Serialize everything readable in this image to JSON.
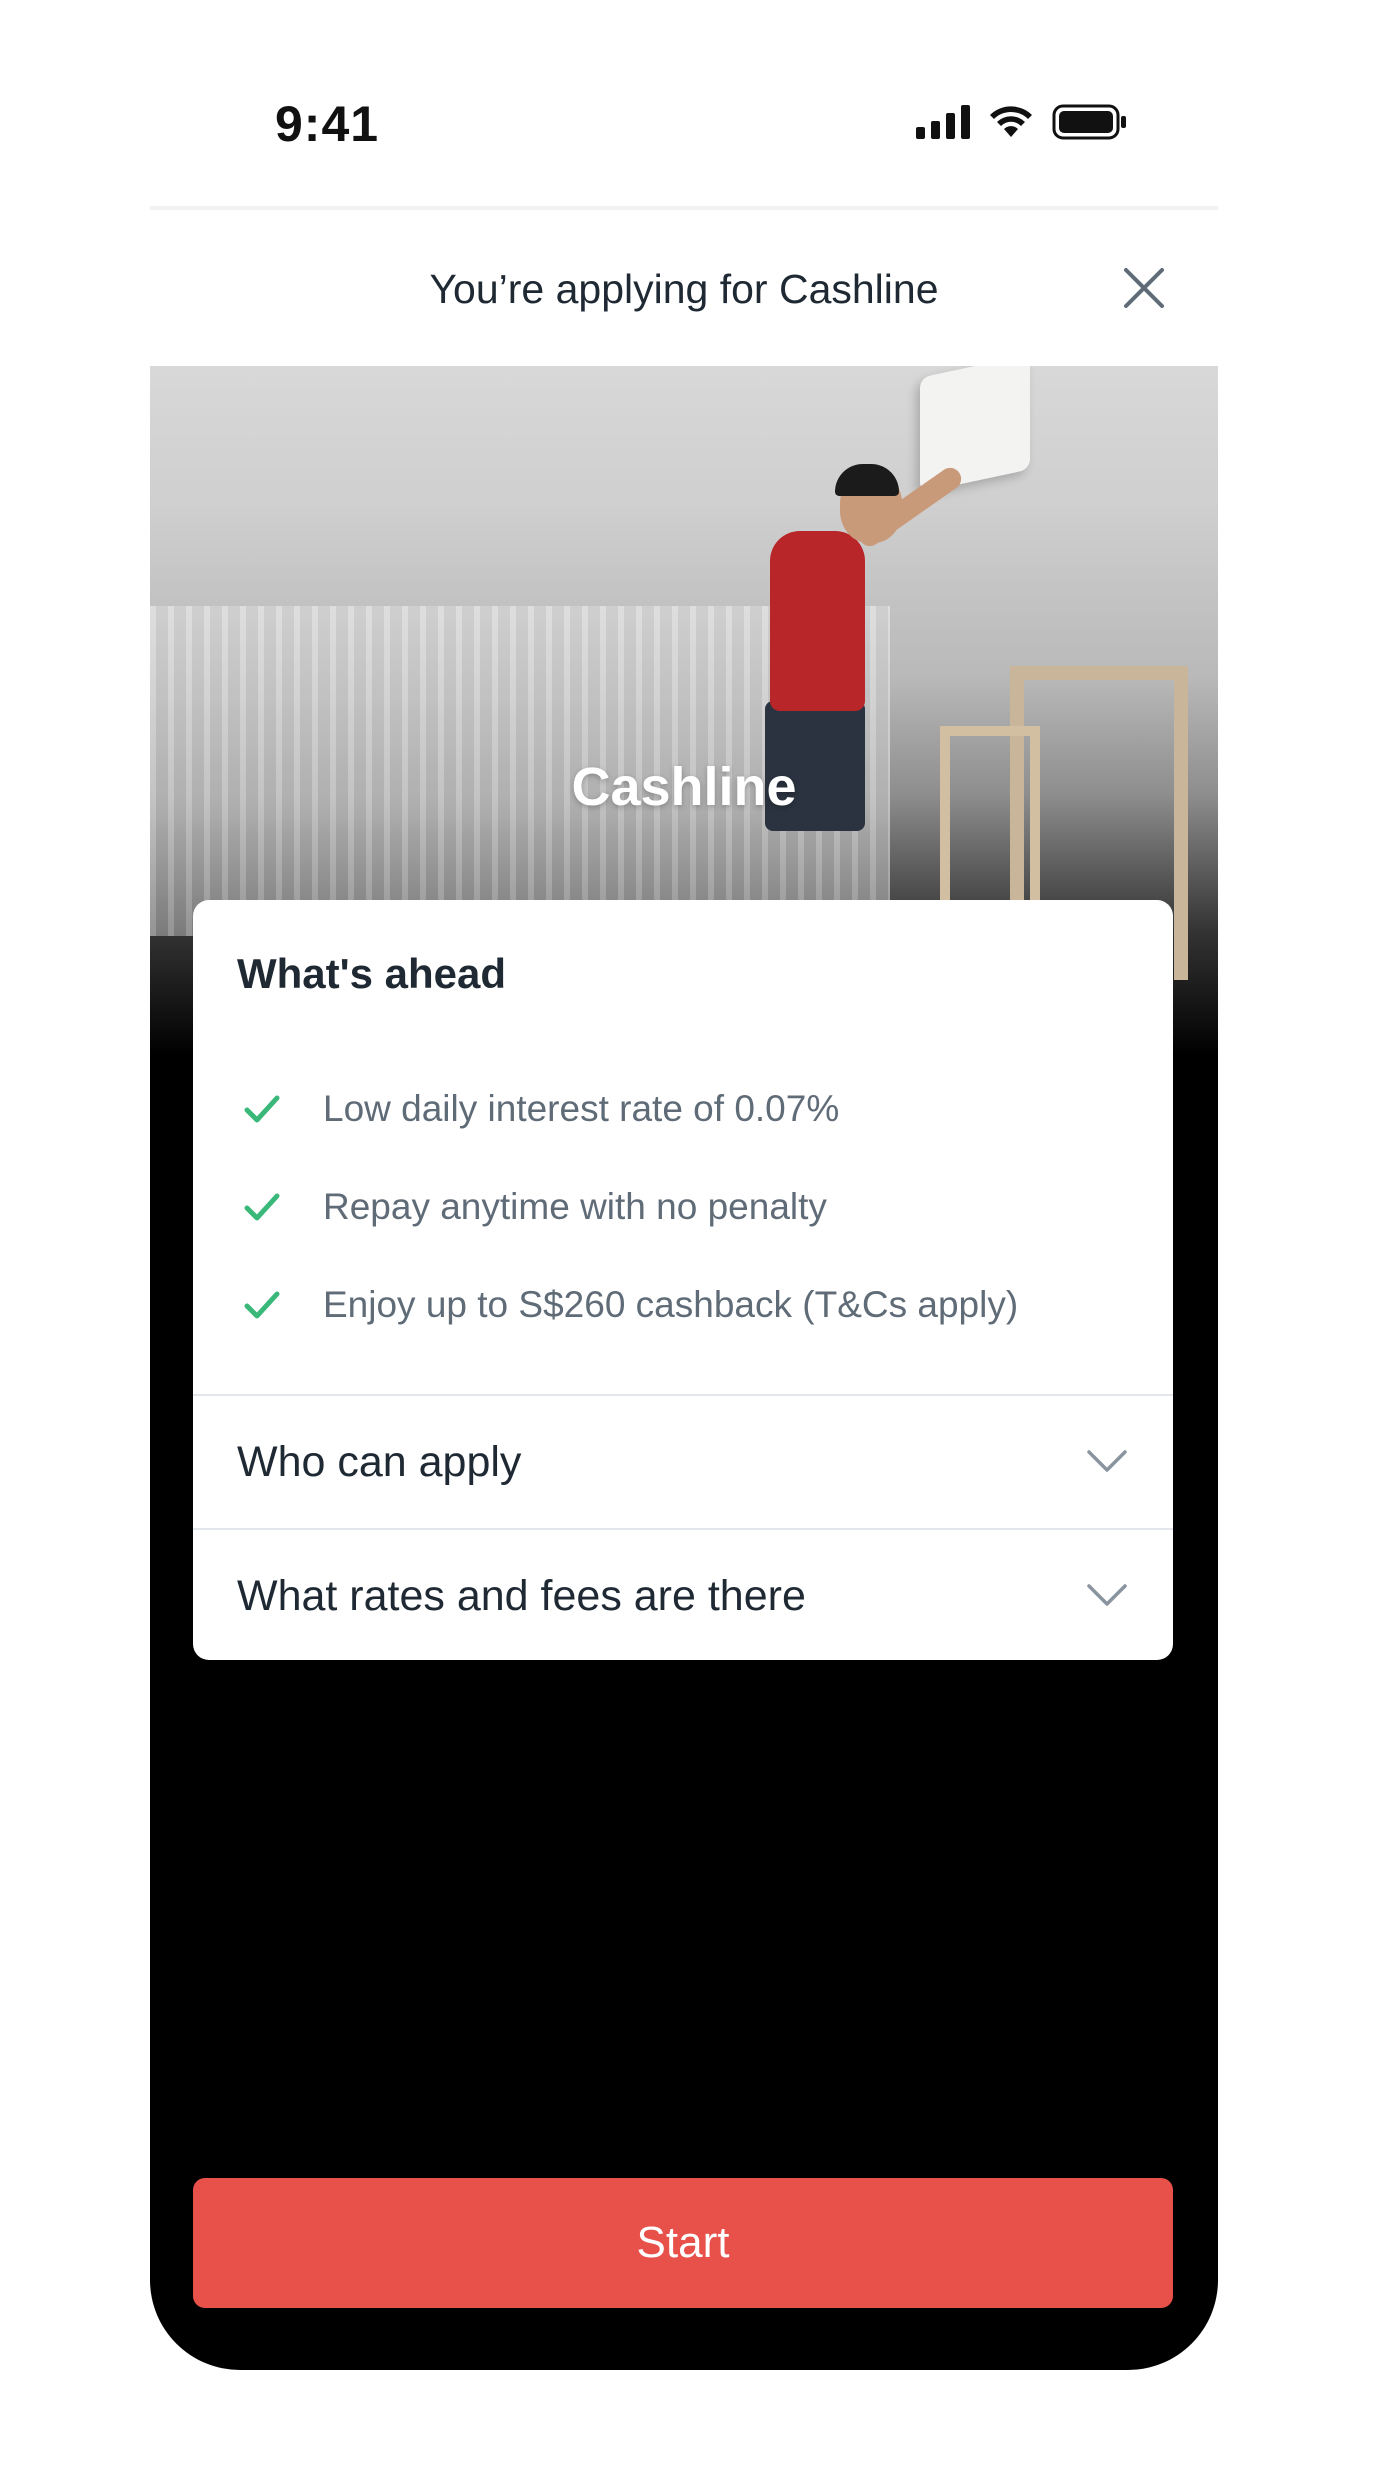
{
  "status_bar": {
    "time": "9:41"
  },
  "header": {
    "title": "You’re applying for Cashline"
  },
  "hero": {
    "title": "Cashline"
  },
  "card": {
    "heading": "What's ahead",
    "benefits": [
      {
        "text": "Low daily interest rate of 0.07%"
      },
      {
        "text": "Repay anytime with no penalty"
      },
      {
        "text": "Enjoy up to S$260 cashback (T&Cs apply)"
      }
    ],
    "accordions": [
      {
        "label": "Who can apply"
      },
      {
        "label": "What rates and fees are there"
      }
    ]
  },
  "cta": {
    "label": "Start"
  },
  "colors": {
    "accent": "#e8504a",
    "check": "#3ab87a",
    "text_primary": "#1f2933",
    "text_secondary": "#5f6b77"
  }
}
